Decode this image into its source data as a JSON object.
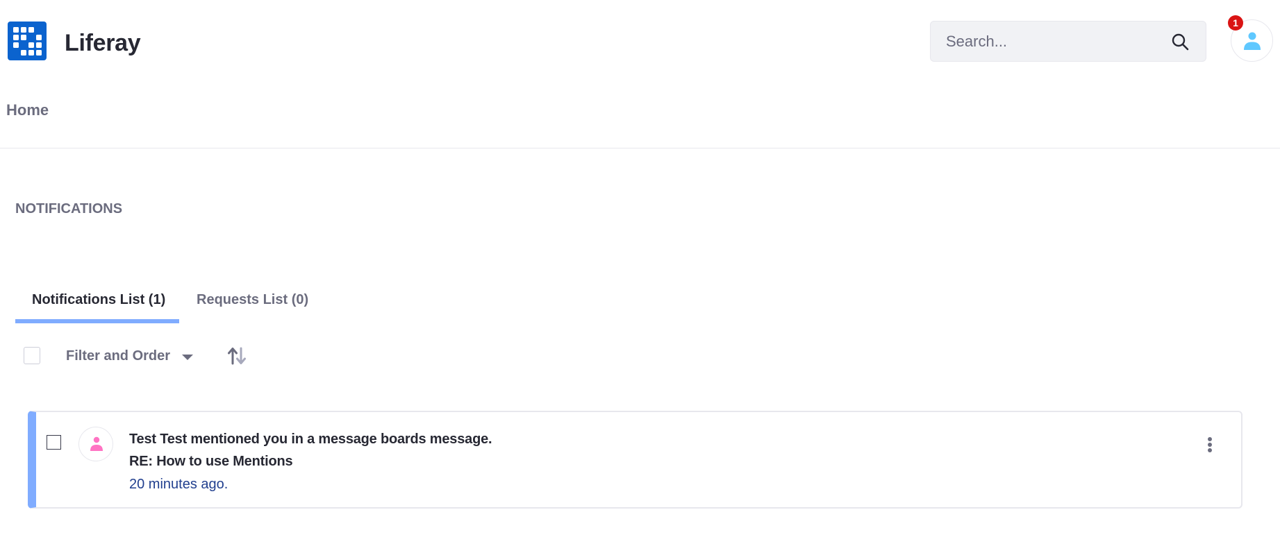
{
  "header": {
    "logo_icon": "liferay-logo-grid",
    "brand": "Liferay",
    "search": {
      "placeholder": "Search...",
      "value": "",
      "icon": "search-icon"
    },
    "user": {
      "icon": "user-icon",
      "notification_count": "1",
      "badge_color": "#da1414",
      "avatar_color": "#5fc8ff"
    }
  },
  "nav": {
    "home_label": "Home"
  },
  "page": {
    "section_title": "NOTIFICATIONS",
    "tabs": [
      {
        "label": "Notifications List (1)",
        "active": true
      },
      {
        "label": "Requests List (0)",
        "active": false
      }
    ],
    "toolbar": {
      "filter_label": "Filter and Order",
      "filter_icon": "caret-down-icon",
      "sort_icon": "sort-order-icon"
    },
    "notifications": [
      {
        "title": "Test Test mentioned you in a message boards message.",
        "subtitle": "RE: How to use Mentions",
        "time": "20 minutes ago.",
        "avatar_icon": "user-icon",
        "avatar_color": "#ff73c3",
        "unread": true,
        "actions_icon": "ellipsis-v-icon"
      }
    ]
  },
  "colors": {
    "accent": "#80acff",
    "brand": "#0b63ce",
    "text": "#272833",
    "secondary": "#6b6c7e",
    "link": "#22408f"
  }
}
